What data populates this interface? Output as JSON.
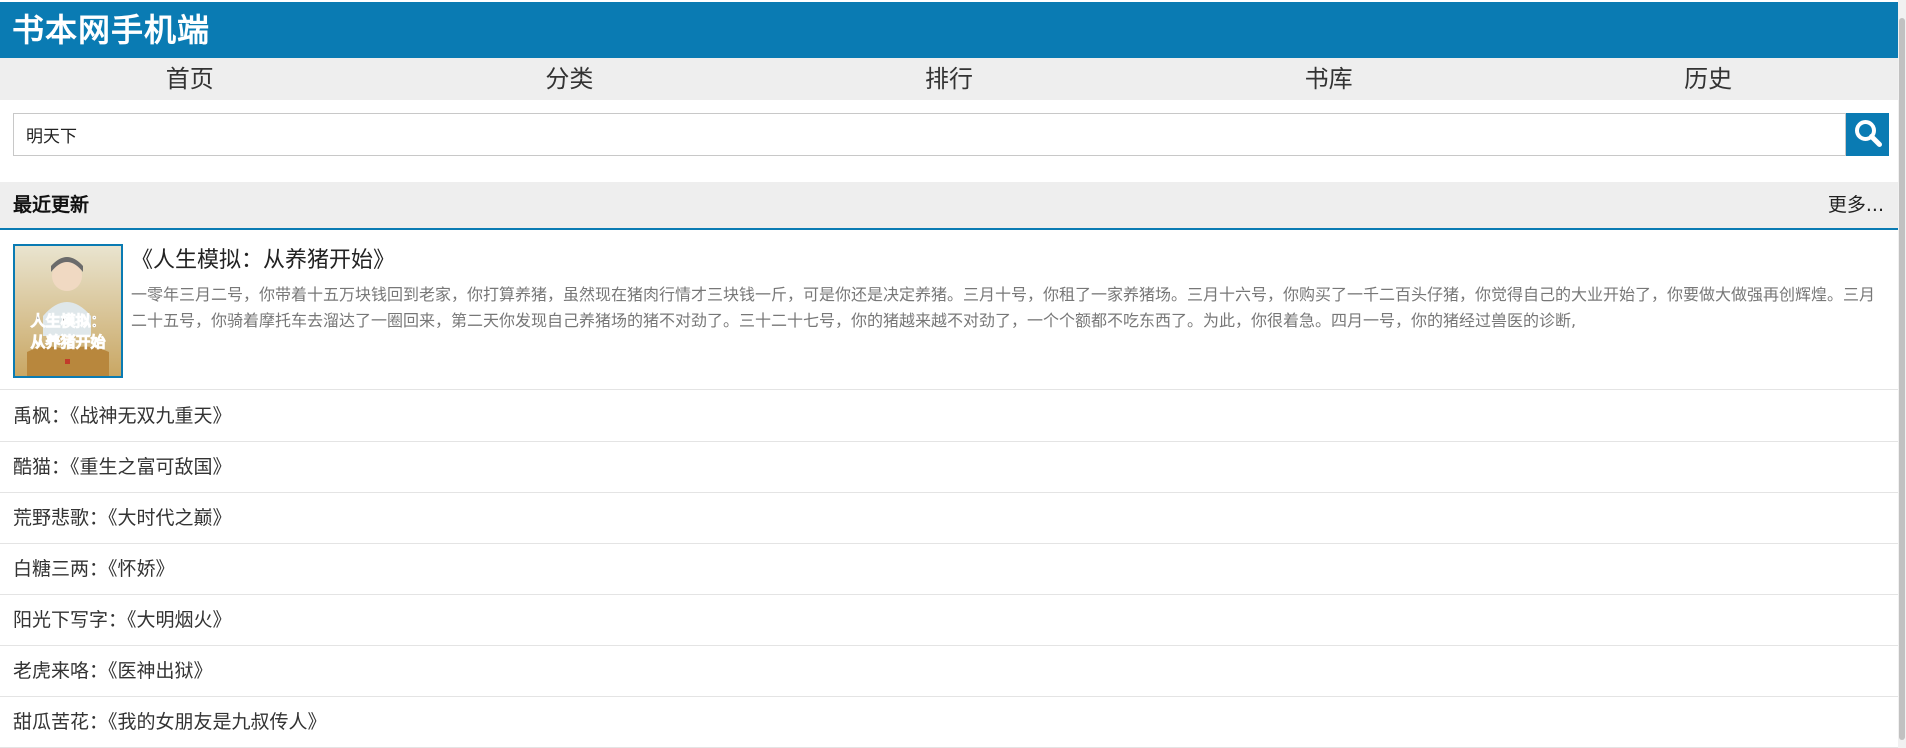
{
  "header": {
    "site_title": "书本网手机端"
  },
  "nav": {
    "items": [
      {
        "label": "首页"
      },
      {
        "label": "分类"
      },
      {
        "label": "排行"
      },
      {
        "label": "书库"
      },
      {
        "label": "历史"
      }
    ]
  },
  "search": {
    "value": "明天下",
    "icon": "search-icon"
  },
  "section": {
    "title": "最近更新",
    "more": "更多..."
  },
  "featured": {
    "title": "《人生模拟：从养猪开始》",
    "description": "一零年三月二号，你带着十五万块钱回到老家，你打算养猪，虽然现在猪肉行情才三块钱一斤，可是你还是决定养猪。三月十号，你租了一家养猪场。三月十六号，你购买了一千二百头仔猪，你觉得自己的大业开始了，你要做大做强再创辉煌。三月二十五号，你骑着摩托车去溜达了一圈回来，第二天你发现自己养猪场的猪不对劲了。三十二十七号，你的猪越来越不对劲了，一个个额都不吃东西了。为此，你很着急。四月一号，你的猪经过兽医的诊断,",
    "cover": {
      "line1": "人生模拟：",
      "line2": "从养猪开始"
    }
  },
  "list": [
    {
      "text": "禹枫：《战神无双九重天》"
    },
    {
      "text": "酷猫：《重生之富可敌国》"
    },
    {
      "text": "荒野悲歌：《大时代之巅》"
    },
    {
      "text": "白糖三两：《怀娇》"
    },
    {
      "text": "阳光下写字：《大明烟火》"
    },
    {
      "text": "老虎来咯：《医神出狱》"
    },
    {
      "text": "甜瓜苦花：《我的女朋友是九叔传人》"
    }
  ],
  "colors": {
    "brand": "#0a7bb3",
    "nav_bg": "#eeeeee",
    "desc_text": "#777777"
  }
}
